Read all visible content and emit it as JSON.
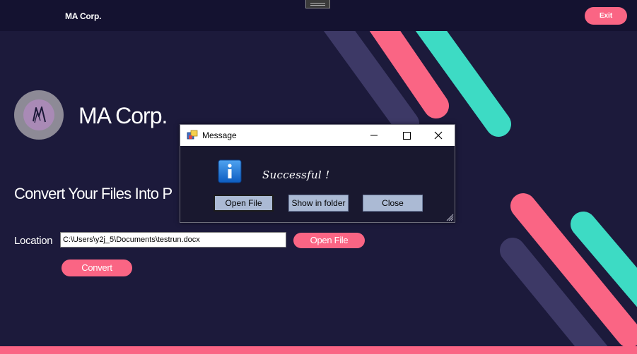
{
  "topbar": {
    "brand": "MA Corp.",
    "exit_label": "Exit"
  },
  "main": {
    "title": "MA Corp.",
    "headline": "Convert Your Files Into P",
    "location_label": "Location",
    "path_value": "C:\\Users\\y2j_5\\Documents\\testrun.docx",
    "open_file_label": "Open File",
    "convert_label": "Convert"
  },
  "dialog": {
    "title": "Message",
    "message": "Successful !",
    "buttons": {
      "open_file": "Open File",
      "show_in_folder": "Show in folder",
      "close": "Close"
    }
  },
  "icons": {
    "logo": "ma-monogram-logo",
    "dialog_app": "window-app-icon",
    "info": "info-icon",
    "minimize": "minimize-icon",
    "maximize": "maximize-icon",
    "close": "close-icon"
  },
  "colors": {
    "background": "#1c1a3b",
    "topbar": "#141230",
    "accent_pink": "#fa6584",
    "accent_teal": "#3ddbc4",
    "stripe_purple": "#3d3966",
    "dialog_button": "#abbad4"
  }
}
